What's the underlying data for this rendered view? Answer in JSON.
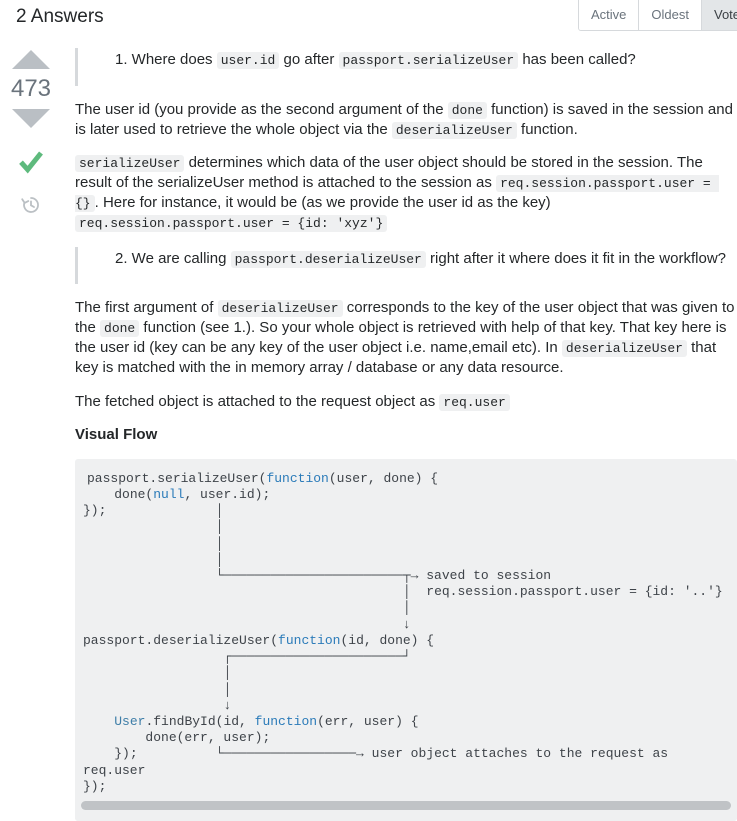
{
  "header": {
    "title": "2 Answers",
    "tabs": [
      {
        "label": "Active",
        "selected": false
      },
      {
        "label": "Oldest",
        "selected": false
      },
      {
        "label": "Votes",
        "selected": true
      }
    ]
  },
  "answer": {
    "vote_count": "473",
    "icons": {
      "upvote": "triangle-up-icon",
      "downvote": "triangle-down-icon",
      "accepted": "checkmark-icon",
      "history": "history-clock-icon"
    },
    "colors": {
      "accepted_check": "#5eba7d",
      "arrow": "#babfc4",
      "code_background": "#eff0f1",
      "keyword": "#2b7bb9"
    },
    "quote1": {
      "prefix": "1. Where does ",
      "code1": "user.id",
      "mid": " go after ",
      "code2": "passport.serializeUser",
      "suffix": " has been called?"
    },
    "para1": {
      "t1": "The user id (you provide as the second argument of the ",
      "c1": "done",
      "t2": " function) is saved in the session and is later used to retrieve the whole object via the ",
      "c2": "deserializeUser",
      "t3": " function."
    },
    "para2": {
      "c1": "serializeUser",
      "t1": " determines which data of the user object should be stored in the session. The result of the serializeUser method is attached to the session as ",
      "c2": "req.session.passport.user = {}",
      "t2": ". Here for instance, it would be (as we provide the user id as the key) ",
      "c3": "req.session.passport.user = {id: 'xyz'}"
    },
    "quote2": {
      "prefix": "2. We are calling ",
      "code1": "passport.deserializeUser",
      "suffix": " right after it where does it fit in the workflow?"
    },
    "para3": {
      "t1": "The first argument of ",
      "c1": "deserializeUser",
      "t2": " corresponds to the key of the user object that was given to the ",
      "c2": "done",
      "t3": " function (see 1.). So your whole object is retrieved with help of that key. That key here is the user id (key can be any key of the user object i.e. name,email etc). In ",
      "c3": "deserializeUser",
      "t4": " that key is matched with the in memory array / database or any data resource."
    },
    "para4": {
      "t1": "The fetched object is attached to the request object as ",
      "c1": "req.user"
    },
    "visual_flow_title": "Visual Flow",
    "code_lines": [
      [
        {
          "t": "passport.serializeUser(",
          "k": "plain"
        },
        {
          "t": "function",
          "k": "kw"
        },
        {
          "t": "(user, done) {",
          "k": "plain"
        }
      ],
      [
        {
          "t": "    done(",
          "k": "plain"
        },
        {
          "t": "null",
          "k": "kw"
        },
        {
          "t": ", user.id);",
          "k": "plain"
        }
      ],
      [
        {
          "t": "});              │",
          "k": "plain"
        }
      ],
      [
        {
          "t": "                 │",
          "k": "plain"
        }
      ],
      [
        {
          "t": "                 │",
          "k": "plain"
        }
      ],
      [
        {
          "t": "                 │",
          "k": "plain"
        }
      ],
      [
        {
          "t": "                 └───────────────────────┬→ saved to session",
          "k": "plain"
        }
      ],
      [
        {
          "t": "                                         │  req.session.passport.user = {id: '..'}",
          "k": "plain"
        }
      ],
      [
        {
          "t": "                                         │",
          "k": "plain"
        }
      ],
      [
        {
          "t": "                                         ↓",
          "k": "plain"
        }
      ],
      [
        {
          "t": "passport.deserializeUser(",
          "k": "plain"
        },
        {
          "t": "function",
          "k": "kw"
        },
        {
          "t": "(id, done) {",
          "k": "plain"
        }
      ],
      [
        {
          "t": "                  ┌──────────────────────┘",
          "k": "plain"
        }
      ],
      [
        {
          "t": "                  │",
          "k": "plain"
        }
      ],
      [
        {
          "t": "                  │",
          "k": "plain"
        }
      ],
      [
        {
          "t": "                  ↓",
          "k": "plain"
        }
      ],
      [
        {
          "t": "    ",
          "k": "plain"
        },
        {
          "t": "User",
          "k": "fn"
        },
        {
          "t": ".findById(id, ",
          "k": "plain"
        },
        {
          "t": "function",
          "k": "kw"
        },
        {
          "t": "(err, user) {",
          "k": "plain"
        }
      ],
      [
        {
          "t": "        done(err, user);",
          "k": "plain"
        }
      ],
      [
        {
          "t": "    });          └─────────────────→ user object attaches to the request as req.user",
          "k": "plain"
        }
      ],
      [
        {
          "t": "});",
          "k": "plain"
        }
      ]
    ]
  }
}
